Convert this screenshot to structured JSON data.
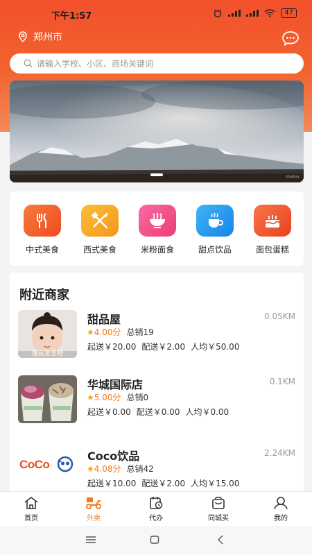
{
  "status_bar": {
    "time": "下午1:57",
    "battery": "47"
  },
  "header": {
    "city": "郑州市"
  },
  "search": {
    "placeholder": "请输入学校、小区、商场关键词"
  },
  "banner": {
    "watermark": "pixabay"
  },
  "categories": [
    {
      "label": "中式美食",
      "icon": "fork-knife-icon",
      "color": "#f15a24"
    },
    {
      "label": "西式美食",
      "icon": "fork-knife-cross-icon",
      "color": "#f5a623"
    },
    {
      "label": "米粉面食",
      "icon": "noodle-bowl-icon",
      "color": "#f04f8a"
    },
    {
      "label": "甜点饮品",
      "icon": "coffee-cup-icon",
      "color": "#1e9bf0"
    },
    {
      "label": "面包蛋糕",
      "icon": "cake-icon",
      "color": "#f0502a"
    }
  ],
  "nearby": {
    "title": "附近商家",
    "shops": [
      {
        "name": "甜品屋",
        "distance": "0.05KM",
        "rating": "4.00分",
        "sold": "总销19",
        "min_order": "起送￥20.00",
        "delivery_fee": "配送￥2.00",
        "avg_price": "人均￥50.00",
        "thumb_caption": "懂我意思吧"
      },
      {
        "name": "华城国际店",
        "distance": "0.1KM",
        "rating": "5.00分",
        "sold": "总销0",
        "min_order": "起送￥0.00",
        "delivery_fee": "配送￥0.00",
        "avg_price": "人均￥0.00"
      },
      {
        "name": "Coco饮品",
        "distance": "2.24KM",
        "rating": "4.08分",
        "sold": "总销42",
        "min_order": "起送￥10.00",
        "delivery_fee": "配送￥2.00",
        "avg_price": "人均￥15.00",
        "logo_text": "CoCo"
      }
    ]
  },
  "tabbar": [
    {
      "label": "首页",
      "icon": "home-icon",
      "active": false
    },
    {
      "label": "外卖",
      "icon": "scooter-icon",
      "active": true
    },
    {
      "label": "代办",
      "icon": "calendar-clock-icon",
      "active": false
    },
    {
      "label": "同城买",
      "icon": "shopping-bag-icon",
      "active": false
    },
    {
      "label": "我的",
      "icon": "user-icon",
      "active": false
    }
  ],
  "colors": {
    "accent": "#f37b1d",
    "header": "#f3502b"
  }
}
